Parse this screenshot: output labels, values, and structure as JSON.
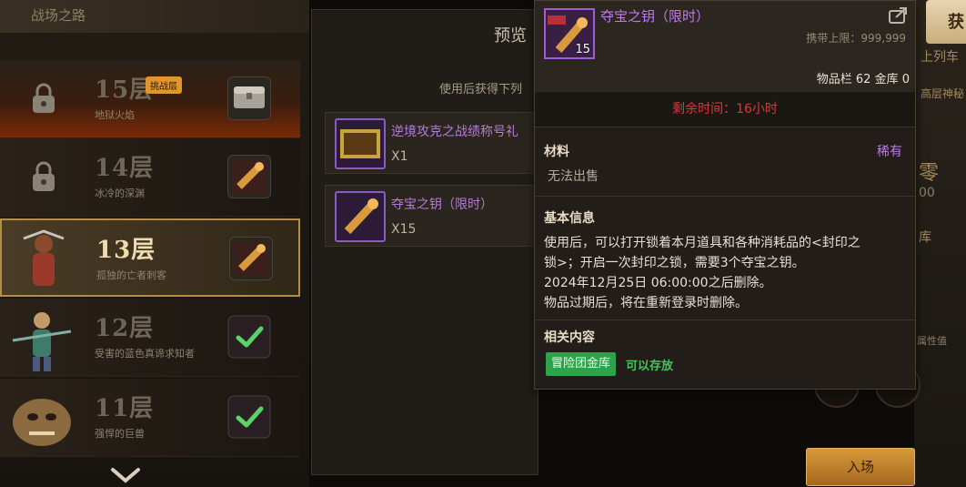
{
  "floors_header": "战场之路",
  "floors": [
    {
      "num": "15层",
      "sub": "地狱火焰",
      "badge": "挑战层",
      "state": "locked"
    },
    {
      "num": "14层",
      "sub": "冰冷的深渊",
      "badge": "",
      "state": "locked"
    },
    {
      "num": "13层",
      "sub": "孤独的亡者刺客",
      "badge": "",
      "state": "current"
    },
    {
      "num": "12层",
      "sub": "受害的蓝色真谛求知者",
      "badge": "",
      "state": "cleared"
    },
    {
      "num": "11层",
      "sub": "强悍的巨兽",
      "badge": "",
      "state": "cleared"
    }
  ],
  "reward_panel": {
    "title": "预览",
    "desc": "使用后获得下列",
    "items": [
      {
        "name": "逆境攻克之战绩称号礼",
        "qty": "X1"
      },
      {
        "name": "夺宝之钥（限时）",
        "qty": "X15"
      }
    ]
  },
  "right_side": {
    "get_button": "获",
    "line1": "上列车",
    "line2": "高层神秘",
    "line3": "零",
    "line4": "00",
    "line5": "库",
    "line6": "属性值",
    "enter_button": "入场"
  },
  "tooltip": {
    "item_name": "夺宝之钥（限时）",
    "icon_count": "15",
    "carry_limit": "携带上限：999,999",
    "inventory": "物品栏 62 金库 0",
    "timer": "剩余时间：16小时",
    "section_material": "材料",
    "rarity": "稀有",
    "unsellable": "无法出售",
    "section_basic": "基本信息",
    "basic_lines": [
      "使用后，可以打开锁着本月道具和各种消耗品的<封印之",
      "锁>；开启一次封印之锁，需要3个夺宝之钥。",
      "2024年12月25日 06:00:00之后删除。",
      "物品过期后，将在重新登录时删除。"
    ],
    "section_related": "相关内容",
    "tag": "冒险团金库",
    "tag_note": "可以存放"
  },
  "colors": {
    "rare_purple": "#c278f2",
    "timer_red": "#e03636",
    "tag_green": "#2ea24a",
    "gold_accent": "#b58e45"
  }
}
